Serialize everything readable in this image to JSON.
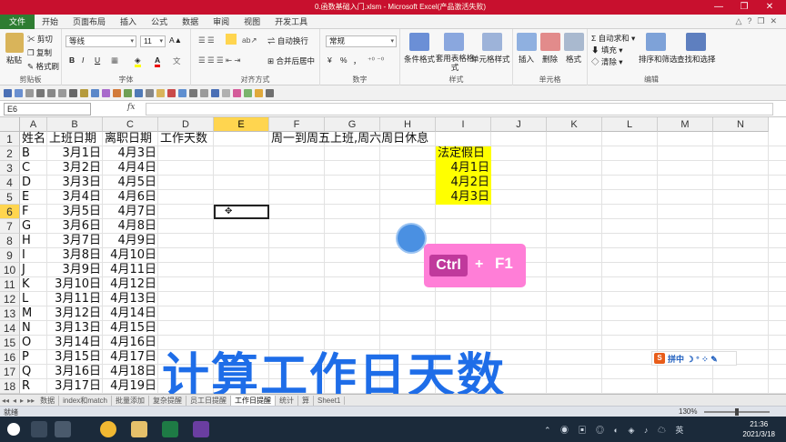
{
  "window": {
    "title": "0.函数基础入门.xlsm - Microsoft Excel(产品激活失败)",
    "controls": [
      "—",
      "❐",
      "✕"
    ]
  },
  "menu": {
    "tabs": [
      "文件",
      "开始",
      "页面布局",
      "插入",
      "公式",
      "数据",
      "审阅",
      "视图",
      "开发工具"
    ],
    "right_controls": [
      "△",
      "?",
      "❐",
      "✕"
    ]
  },
  "ribbon": {
    "clipboard": {
      "paste": "粘贴",
      "cut": "剪切",
      "copy": "复制",
      "format_painter": "格式刷",
      "label": "剪贴板"
    },
    "font": {
      "family": "等线",
      "size": "11",
      "bold": "B",
      "italic": "I",
      "underline": "U",
      "grow": "A▲",
      "shrink": "A▼",
      "font_color_glyph": "A",
      "label": "字体"
    },
    "alignment": {
      "wrap": "自动换行",
      "merge": "合并后居中",
      "label": "对齐方式"
    },
    "number": {
      "format": "常规",
      "currency": "¥",
      "percent": "%",
      "comma": "，",
      "label": "数字"
    },
    "styles": {
      "conditional": "条件格式",
      "table": "套用表格格式",
      "cell_styles": "单元格样式",
      "label": "样式"
    },
    "cells": {
      "insert": "插入",
      "delete": "删除",
      "format": "格式",
      "label": "单元格"
    },
    "editing": {
      "autosum": "自动求和",
      "fill": "填充",
      "clear": "清除",
      "sort": "排序和筛选",
      "find": "查找和选择",
      "label": "编辑"
    }
  },
  "formula_bar": {
    "name_box": "E6",
    "fx": "fx",
    "value": ""
  },
  "grid": {
    "columns": [
      "A",
      "B",
      "C",
      "D",
      "E",
      "F",
      "G",
      "H",
      "I",
      "J",
      "K",
      "L",
      "M",
      "N"
    ],
    "rows": [
      "1",
      "2",
      "3",
      "4",
      "5",
      "6",
      "7",
      "8",
      "9",
      "10",
      "11",
      "12",
      "13",
      "14",
      "15",
      "16",
      "17",
      "18"
    ],
    "active_column": "E",
    "active_row": "6",
    "headers": {
      "a": "姓名",
      "b": "上班日期",
      "c": "离职日期",
      "d": "工作天数",
      "f": "周一到周五上班,周六周日休息"
    },
    "records": [
      {
        "name": "B",
        "start": "3月1日",
        "end": "4月3日"
      },
      {
        "name": "C",
        "start": "3月2日",
        "end": "4月4日"
      },
      {
        "name": "D",
        "start": "3月3日",
        "end": "4月5日"
      },
      {
        "name": "E",
        "start": "3月4日",
        "end": "4月6日"
      },
      {
        "name": "F",
        "start": "3月5日",
        "end": "4月7日"
      },
      {
        "name": "G",
        "start": "3月6日",
        "end": "4月8日"
      },
      {
        "name": "H",
        "start": "3月7日",
        "end": "4月9日"
      },
      {
        "name": "I",
        "start": "3月8日",
        "end": "4月10日"
      },
      {
        "name": "J",
        "start": "3月9日",
        "end": "4月11日"
      },
      {
        "name": "K",
        "start": "3月10日",
        "end": "4月12日"
      },
      {
        "name": "L",
        "start": "3月11日",
        "end": "4月13日"
      },
      {
        "name": "M",
        "start": "3月12日",
        "end": "4月14日"
      },
      {
        "name": "N",
        "start": "3月13日",
        "end": "4月15日"
      },
      {
        "name": "O",
        "start": "3月14日",
        "end": "4月16日"
      },
      {
        "name": "P",
        "start": "3月15日",
        "end": "4月17日"
      },
      {
        "name": "Q",
        "start": "3月16日",
        "end": "4月18日"
      },
      {
        "name": "R",
        "start": "3月17日",
        "end": "4月19日"
      }
    ],
    "holidays": {
      "header": "法定假日",
      "dates": [
        "4月1日",
        "4月2日",
        "4月3日"
      ]
    },
    "highlight_color": "#ffff00"
  },
  "overlay": {
    "key_ctrl": "Ctrl",
    "key_plus": "+",
    "key_f1": "F1",
    "caption": "计算工作日天数",
    "ime": "拼中 ☽ ° ⁘ ✎",
    "ime_logo": "S"
  },
  "sheets": {
    "nav": [
      "◂◂",
      "◂",
      "▸",
      "▸▸"
    ],
    "tabs": [
      "数据",
      "index和match",
      "批量添加",
      "复杂提醒",
      "员工日提醒",
      "工作日提醒",
      "统计",
      "算",
      "Sheet1"
    ]
  },
  "status": {
    "ready": "就绪",
    "zoom": "130%"
  },
  "taskbar": {
    "time": "21:36",
    "date": "2021/3/18"
  },
  "colors": {
    "title_bar": "#c8102e",
    "file_tab": "#2e7d32",
    "active_header": "#ffd54f",
    "caption": "#1e6de8",
    "keyhint": "#ff7ed7"
  }
}
